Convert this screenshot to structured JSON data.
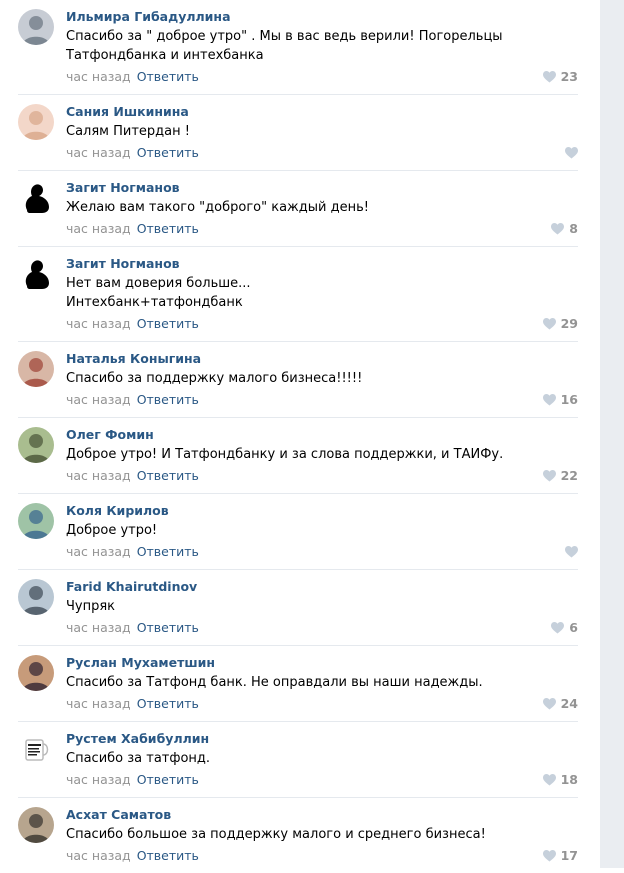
{
  "comments": [
    {
      "author": "Ильмира Гибадуллина",
      "lines": [
        "Спасибо за \" доброе утро\" . Мы в вас ведь верили! Погорельцы",
        "Татфондбанка и интехбанка"
      ],
      "time": "час назад",
      "reply": "Ответить",
      "likes": "23",
      "avatar_icon": "photo-avatar",
      "avatar_colors": [
        "#c7ccd4",
        "#6f7a86"
      ]
    },
    {
      "author": "Сания Ишкинина",
      "lines": [
        "Салям Питердан !"
      ],
      "time": "час назад",
      "reply": "Ответить",
      "likes": "",
      "avatar_icon": "photo-avatar",
      "avatar_colors": [
        "#f3d7c9",
        "#d9a98c"
      ]
    },
    {
      "author": "Загит Ногманов",
      "lines": [
        "Желаю вам такого \"доброго\" каждый день!"
      ],
      "time": "час назад",
      "reply": "Ответить",
      "likes": "8",
      "avatar_icon": "silhouette-avatar",
      "avatar_colors": [
        "#ffffff",
        "#000000"
      ]
    },
    {
      "author": "Загит Ногманов",
      "lines": [
        "Нет вам доверия больше...",
        "Интехбанк+татфондбанк"
      ],
      "time": "час назад",
      "reply": "Ответить",
      "likes": "29",
      "avatar_icon": "silhouette-avatar",
      "avatar_colors": [
        "#ffffff",
        "#000000"
      ]
    },
    {
      "author": "Наталья Коныгина",
      "lines": [
        "Спасибо за поддержку малого бизнеса!!!!!"
      ],
      "time": "час назад",
      "reply": "Ответить",
      "likes": "16",
      "avatar_icon": "photo-avatar",
      "avatar_colors": [
        "#d8b7a6",
        "#a24a3c"
      ]
    },
    {
      "author": "Олег Фомин",
      "lines": [
        "Доброе утро! И Татфондбанку и за слова поддержки, и ТАИФу."
      ],
      "time": "час назад",
      "reply": "Ответить",
      "likes": "22",
      "avatar_icon": "photo-avatar",
      "avatar_colors": [
        "#a9bd8f",
        "#4f5b3c"
      ]
    },
    {
      "author": "Коля Кирилов",
      "lines": [
        "Доброе утро!"
      ],
      "time": "час назад",
      "reply": "Ответить",
      "likes": "",
      "avatar_icon": "photo-avatar",
      "avatar_colors": [
        "#9fc3a6",
        "#3d6b8f"
      ]
    },
    {
      "author": "Farid Khairutdinov",
      "lines": [
        "Чупряк"
      ],
      "time": "час назад",
      "reply": "Ответить",
      "likes": "6",
      "avatar_icon": "photo-avatar",
      "avatar_colors": [
        "#b9c7d3",
        "#46525e"
      ]
    },
    {
      "author": "Руслан Мухаметшин",
      "lines": [
        "Спасибо за Татфонд банк. Не оправдали вы наши надежды."
      ],
      "time": "час назад",
      "reply": "Ответить",
      "likes": "24",
      "avatar_icon": "photo-avatar",
      "avatar_colors": [
        "#c79b7a",
        "#3a2a35"
      ]
    },
    {
      "author": "Рустем Хабибуллин",
      "lines": [
        "Спасибо за татфонд."
      ],
      "time": "час назад",
      "reply": "Ответить",
      "likes": "18",
      "avatar_icon": "mug-avatar",
      "avatar_colors": [
        "#ffffff",
        "#222222"
      ]
    },
    {
      "author": "Асхат Саматов",
      "lines": [
        "Спасибо большое за поддержку малого и среднего бизнеса!"
      ],
      "time": "час назад",
      "reply": "Ответить",
      "likes": "17",
      "avatar_icon": "photo-avatar",
      "avatar_colors": [
        "#b7a58e",
        "#3e3a33"
      ]
    }
  ],
  "colors": {
    "link": "#2a5885",
    "meta": "#939393",
    "heart": "#c6d0db",
    "divider": "#e5e9ee",
    "scroll_gutter": "#eaedf1"
  }
}
